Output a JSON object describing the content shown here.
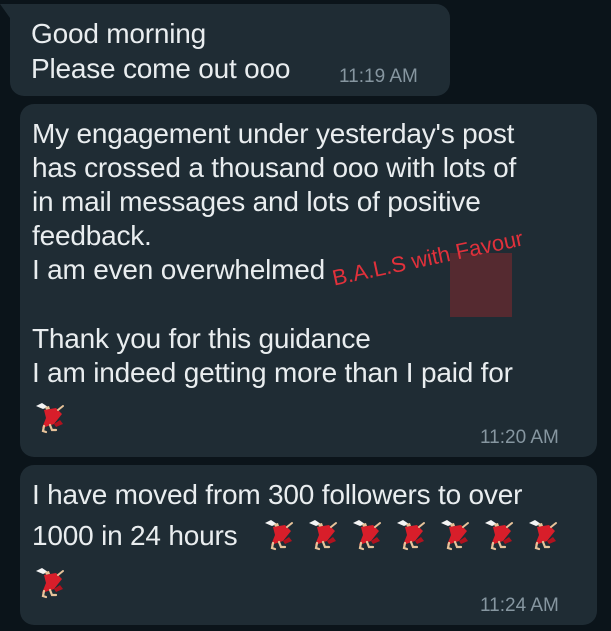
{
  "messages": [
    {
      "lines": [
        "Good morning",
        "Please come out ooo"
      ],
      "time": "11:19 AM"
    },
    {
      "lines": [
        "My engagement under yesterday's post",
        "has crossed a thousand ooo with lots of",
        "in mail messages and lots of positive",
        "feedback.",
        "I am even overwhelmed",
        "",
        "Thank you for this guidance",
        "I am indeed getting more than I paid for"
      ],
      "emoji": [
        "dancer-icon"
      ],
      "time": "11:20 AM"
    },
    {
      "lines": [
        "I have moved from 300 followers to over",
        "1000 in 24 hours"
      ],
      "emoji": [
        "dancer-icon",
        "dancer-icon",
        "dancer-icon",
        "dancer-icon",
        "dancer-icon",
        "dancer-icon",
        "dancer-icon",
        "dancer-icon"
      ],
      "time": "11:24 AM"
    }
  ],
  "watermark": "B.A.L.S with Favour",
  "colors": {
    "background": "#0b141a",
    "bubble": "#1f2c34",
    "text": "#e9edef",
    "timestamp": "#8696a0",
    "watermark": "#e0313b"
  }
}
